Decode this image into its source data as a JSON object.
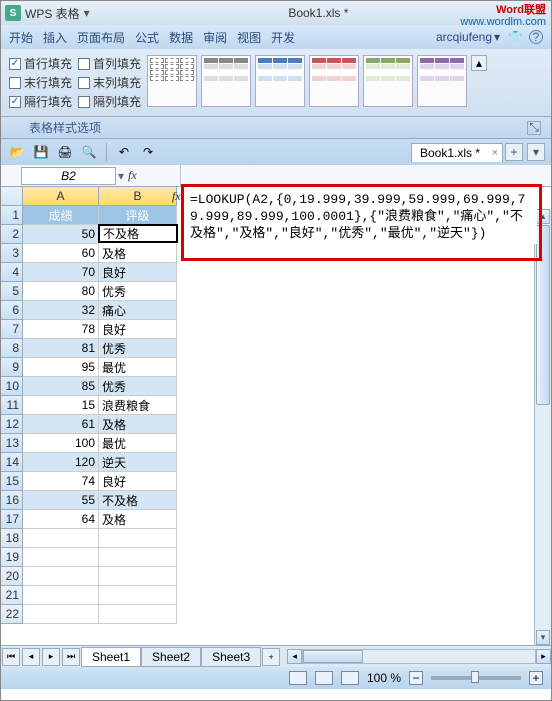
{
  "title_bar": {
    "app_name": "WPS 表格",
    "doc": "Book1.xls *",
    "wm1": "Word联盟",
    "wm2": "www.wordlm.com"
  },
  "menu": {
    "m0": "开始",
    "m1": "插入",
    "m2": "页面布局",
    "m3": "公式",
    "m4": "数据",
    "m5": "审阅",
    "m6": "视图",
    "m7": "开发",
    "user": "arcqiufeng",
    "dd": "▾"
  },
  "ribbon_checks": {
    "c0": "首行填充",
    "c1": "首列填充",
    "c2": "末行填充",
    "c3": "末列填充",
    "c4": "隔行填充",
    "c5": "隔列填充"
  },
  "ribbon_caption": "表格样式选项",
  "qat_tab": "Book1.xls *",
  "name_box": "B2",
  "formula": "=LOOKUP(A2,{0,19.999,39.999,59.999,69.999,79.999,89.999,100.0001},{\"浪费粮食\",\"痛心\",\"不及格\",\"及格\",\"良好\",\"优秀\",\"最优\",\"逆天\"})",
  "cols": {
    "a": "A",
    "b": "B"
  },
  "headers": {
    "a": "成绩",
    "b": "评级"
  },
  "rows": [
    {
      "n": 1
    },
    {
      "n": 2,
      "a": "50",
      "b": "不及格"
    },
    {
      "n": 3,
      "a": "60",
      "b": "及格"
    },
    {
      "n": 4,
      "a": "70",
      "b": "良好"
    },
    {
      "n": 5,
      "a": "80",
      "b": "优秀"
    },
    {
      "n": 6,
      "a": "32",
      "b": "痛心"
    },
    {
      "n": 7,
      "a": "78",
      "b": "良好"
    },
    {
      "n": 8,
      "a": "81",
      "b": "优秀"
    },
    {
      "n": 9,
      "a": "95",
      "b": "最优"
    },
    {
      "n": 10,
      "a": "85",
      "b": "优秀"
    },
    {
      "n": 11,
      "a": "15",
      "b": "浪费粮食"
    },
    {
      "n": 12,
      "a": "61",
      "b": "及格"
    },
    {
      "n": 13,
      "a": "100",
      "b": "最优"
    },
    {
      "n": 14,
      "a": "120",
      "b": "逆天"
    },
    {
      "n": 15,
      "a": "74",
      "b": "良好"
    },
    {
      "n": 16,
      "a": "55",
      "b": "不及格"
    },
    {
      "n": 17,
      "a": "64",
      "b": "及格"
    },
    {
      "n": 18
    },
    {
      "n": 19
    },
    {
      "n": 20
    },
    {
      "n": 21
    },
    {
      "n": 22
    }
  ],
  "sheets": {
    "s1": "Sheet1",
    "s2": "Sheet2",
    "s3": "Sheet3"
  },
  "zoom": "100 %"
}
